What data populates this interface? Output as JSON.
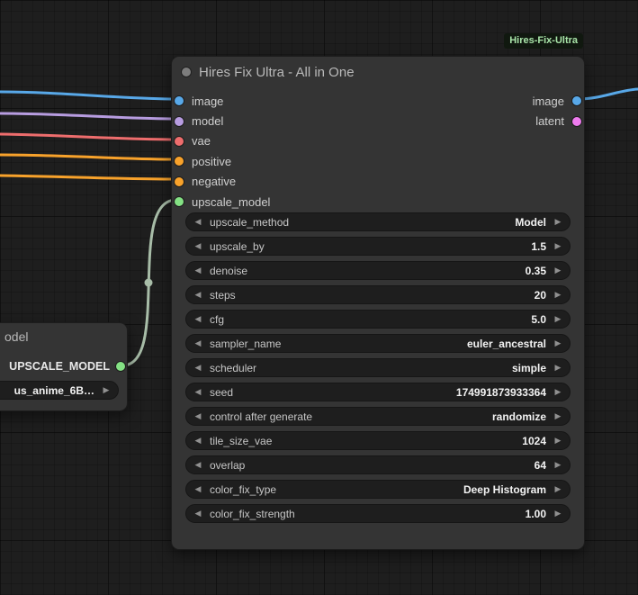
{
  "canvas": {
    "background": "#1e1e1e"
  },
  "badge": {
    "label": "Hires-Fix-Ultra",
    "text_color": "#a9e5a9",
    "bg": "#10180f"
  },
  "icons": {
    "decrement": "◀",
    "increment": "▶"
  },
  "colors": {
    "image": "#58a8e8",
    "model": "#b79ce0",
    "vae": "#ee6d6d",
    "conditioning": "#f8a22b",
    "upscale_model": "#84e184",
    "latent": "#ee7bee",
    "upscale_wire": "#a8bda8"
  },
  "main_node": {
    "title": "Hires Fix Ultra - All in One",
    "inputs": [
      {
        "name": "image",
        "color": "#58a8e8"
      },
      {
        "name": "model",
        "color": "#b79ce0"
      },
      {
        "name": "vae",
        "color": "#ee6d6d"
      },
      {
        "name": "positive",
        "color": "#f8a22b"
      },
      {
        "name": "negative",
        "color": "#f8a22b"
      },
      {
        "name": "upscale_model",
        "color": "#84e184"
      }
    ],
    "outputs": [
      {
        "name": "image",
        "color": "#58a8e8"
      },
      {
        "name": "latent",
        "color": "#ee7bee"
      }
    ],
    "widgets": [
      {
        "label": "upscale_method",
        "value": "Model"
      },
      {
        "label": "upscale_by",
        "value": "1.5"
      },
      {
        "label": "denoise",
        "value": "0.35"
      },
      {
        "label": "steps",
        "value": "20"
      },
      {
        "label": "cfg",
        "value": "5.0"
      },
      {
        "label": "sampler_name",
        "value": "euler_ancestral"
      },
      {
        "label": "scheduler",
        "value": "simple"
      },
      {
        "label": "seed",
        "value": "174991873933364"
      },
      {
        "label": "control after generate",
        "value": "randomize"
      },
      {
        "label": "tile_size_vae",
        "value": "1024"
      },
      {
        "label": "overlap",
        "value": "64"
      },
      {
        "label": "color_fix_type",
        "value": "Deep Histogram"
      },
      {
        "label": "color_fix_strength",
        "value": "1.00"
      }
    ]
  },
  "partial_node": {
    "title_visible": "odel",
    "output": {
      "name": "UPSCALE_MODEL",
      "color": "#84e184"
    },
    "widget_value": "us_anime_6B…"
  }
}
